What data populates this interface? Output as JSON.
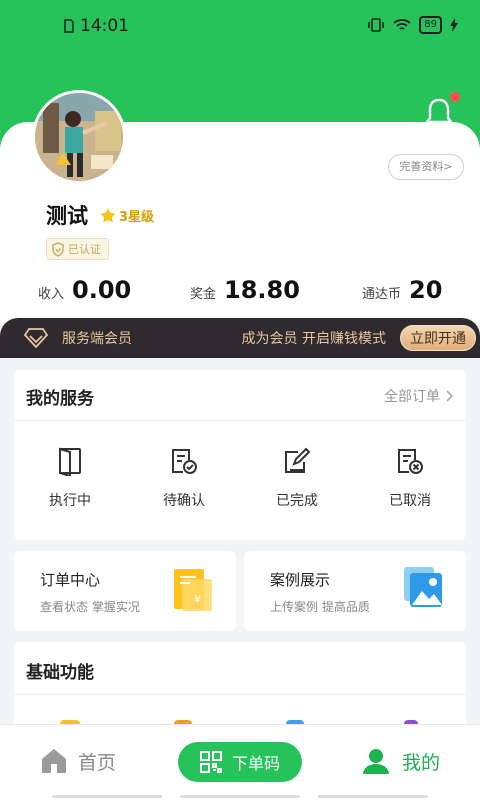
{
  "status": {
    "time": "14:01",
    "battery": "89"
  },
  "profile": {
    "name": "测试",
    "star_level": "3星级",
    "verified": "已认证",
    "edit_profile": "完善资料>"
  },
  "stats": [
    {
      "label": "收入",
      "value": "0.00"
    },
    {
      "label": "奖金",
      "value": "18.80"
    },
    {
      "label": "通达币",
      "value": "20"
    }
  ],
  "member": {
    "title": "服务端会员",
    "slogan": "成为会员  开启赚钱模式",
    "button": "立即开通"
  },
  "services": {
    "title": "我的服务",
    "all_orders": "全部订单",
    "items": [
      {
        "label": "执行中",
        "icon": "door-icon"
      },
      {
        "label": "待确认",
        "icon": "document-check-icon"
      },
      {
        "label": "已完成",
        "icon": "edit-icon"
      },
      {
        "label": "已取消",
        "icon": "document-cancel-icon"
      }
    ]
  },
  "order_center": {
    "title": "订单中心",
    "subtitle": "查看状态  掌握实况"
  },
  "case_show": {
    "title": "案例展示",
    "subtitle": "上传案例  提高品质"
  },
  "basic": {
    "title": "基础功能"
  },
  "tabbar": {
    "home": "首页",
    "order": "下单码",
    "mine": "我的"
  },
  "colors": {
    "brand_green": "#26c25a",
    "member_bar": "#2e2a2d",
    "gold": "#e8c79d"
  }
}
